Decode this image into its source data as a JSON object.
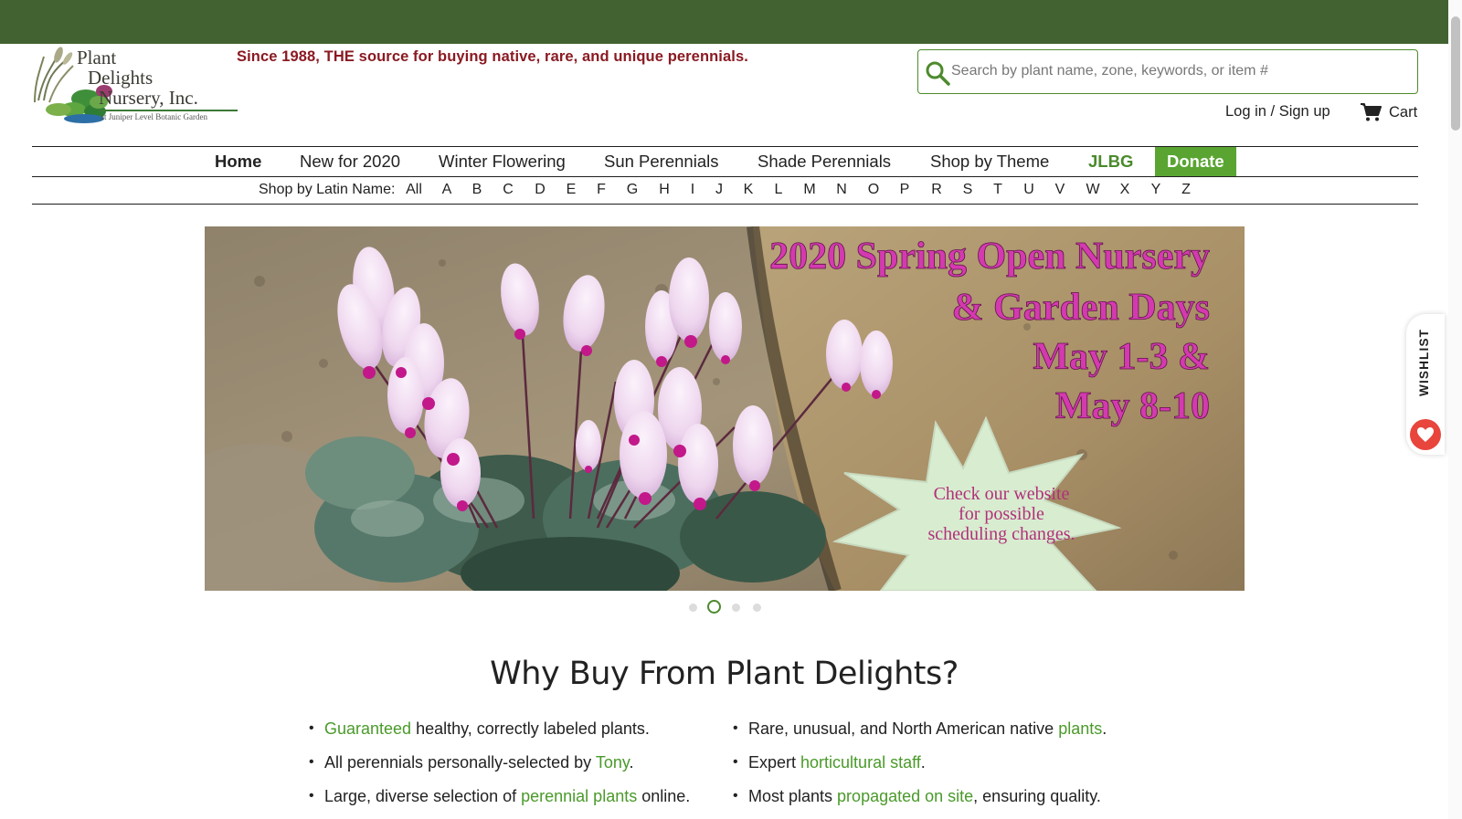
{
  "header": {
    "logo_line1": "Plant",
    "logo_line2": "Delights",
    "logo_line3": "Nursery, Inc.",
    "logo_subline": "at Juniper Level Botanic Garden",
    "tagline": "Since 1988, THE source for buying native, rare, and unique perennials.",
    "search_placeholder": "Search by plant name, zone, keywords, or item #",
    "search_value": "",
    "login_label": "Log in / Sign up",
    "cart_label": "Cart"
  },
  "nav": {
    "items": [
      {
        "label": "Home"
      },
      {
        "label": "New for 2020"
      },
      {
        "label": "Winter Flowering"
      },
      {
        "label": "Sun Perennials"
      },
      {
        "label": "Shade Perennials"
      },
      {
        "label": "Shop by Theme"
      },
      {
        "label": "JLBG"
      },
      {
        "label": "Donate"
      }
    ]
  },
  "latin_nav": {
    "label": "Shop by Latin Name:",
    "letters": [
      "All",
      "A",
      "B",
      "C",
      "D",
      "E",
      "F",
      "G",
      "H",
      "I",
      "J",
      "K",
      "L",
      "M",
      "N",
      "O",
      "P",
      "R",
      "S",
      "T",
      "U",
      "V",
      "W",
      "X",
      "Y",
      "Z"
    ]
  },
  "hero": {
    "title_line1": "2020 Spring Open Nursery",
    "title_line2": "& Garden Days",
    "title_line3": "May 1-3 &",
    "title_line4": "May 8-10",
    "burst_line1": "Check our website",
    "burst_line2": "for possible",
    "burst_line3": "scheduling changes.",
    "slide_count": 4,
    "active_slide": 2
  },
  "why": {
    "heading": "Why Buy From Plant Delights?",
    "left": [
      {
        "link": "Guaranteed",
        "rest": " healthy, correctly labeled plants."
      },
      {
        "pre": "All perennials personally-selected by ",
        "link": "Tony",
        "rest": "."
      },
      {
        "pre": "Large, diverse selection of ",
        "link": "perennial plants",
        "rest": " online."
      }
    ],
    "right": [
      {
        "pre": "Rare, unusual, and North American native ",
        "link": "plants",
        "rest": "."
      },
      {
        "pre": "Expert ",
        "link": "horticultural staff",
        "rest": "."
      },
      {
        "pre": "Most plants ",
        "link": "propagated on site",
        "rest": ", ensuring quality."
      }
    ]
  },
  "wishlist": {
    "label": "WISHLIST"
  },
  "colors": {
    "topbar": "#436231",
    "accent_green": "#5aa532",
    "link_green": "#4a9a2a",
    "tagline_red": "#8a1a22",
    "hero_title_pink": "#d43ab0",
    "burst_fill": "#d8ecd0",
    "burst_text": "#b1307a",
    "wishlist_heart": "#e8453c"
  },
  "icons": {
    "search": "search-icon",
    "cart": "cart-icon",
    "heart": "heart-icon"
  }
}
